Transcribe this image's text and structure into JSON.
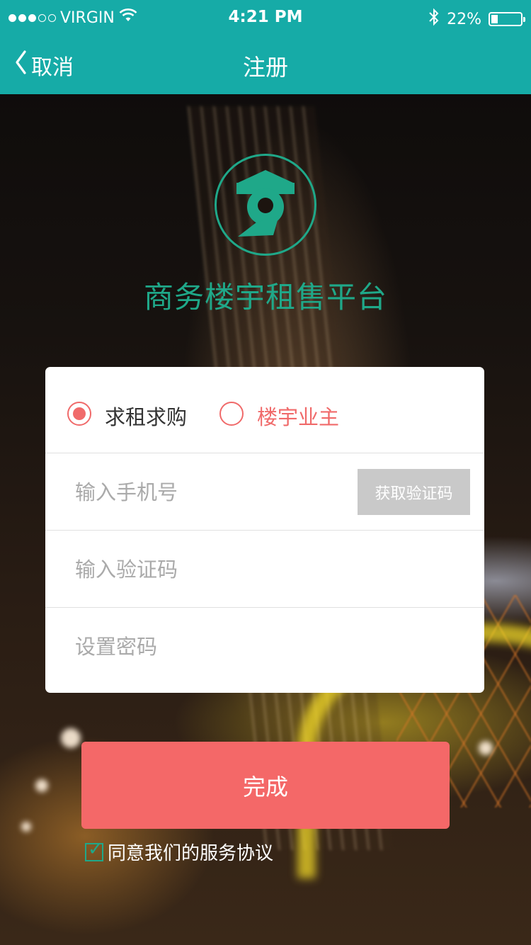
{
  "status_bar": {
    "carrier": "VIRGIN",
    "time": "4:21 PM",
    "battery": "22%",
    "battery_level": 0.22,
    "signal_bars": 3,
    "signal_total": 5,
    "icons": [
      "wifi-icon",
      "bluetooth-icon",
      "battery-icon"
    ]
  },
  "nav": {
    "back_label": "取消",
    "title": "注册"
  },
  "brand": {
    "name": "商务楼宇租售平台",
    "color": "#1fa889"
  },
  "form": {
    "roles": [
      {
        "label": "求租求购",
        "selected": true,
        "color": "#333333"
      },
      {
        "label": "楼宇业主",
        "selected": false,
        "color": "#f06a6a"
      }
    ],
    "phone": {
      "placeholder": "输入手机号",
      "value": ""
    },
    "get_code_label": "获取验证码",
    "code": {
      "placeholder": "输入验证码",
      "value": ""
    },
    "password": {
      "placeholder": "设置密码",
      "value": ""
    },
    "submit_label": "完成",
    "agree_label": "同意我们的服务协议",
    "agree_checked": true
  },
  "colors": {
    "header": "#16aba7",
    "accent": "#f46868",
    "brand": "#1fa889"
  }
}
